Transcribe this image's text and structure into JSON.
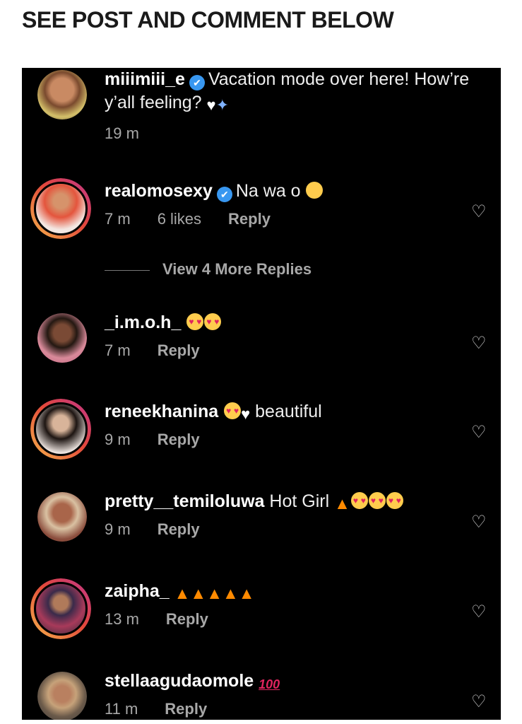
{
  "headline": "SEE POST AND COMMENT BELOW",
  "post": {
    "username": "miiimiii_e",
    "caption": "Vacation mode over here! How’re y’all feeling?",
    "time": "19 m"
  },
  "view_more": "View 4 More Replies",
  "comments": [
    {
      "username": "realomosexy",
      "verified": true,
      "text": "Na wa o",
      "time": "7 m",
      "likes": "6 likes",
      "reply": "Reply"
    },
    {
      "username": "_i.m.o.h_",
      "text": "",
      "time": "7 m",
      "reply": "Reply"
    },
    {
      "username": "reneekhanina",
      "text": "beautiful",
      "time": "9 m",
      "reply": "Reply"
    },
    {
      "username": "pretty__temiloluwa",
      "text": "Hot Girl",
      "time": "9 m",
      "reply": "Reply"
    },
    {
      "username": "zaipha_",
      "text": "",
      "time": "13 m",
      "reply": "Reply"
    },
    {
      "username": "stellaagudaomole",
      "text": "",
      "time": "11 m",
      "reply": "Reply"
    }
  ],
  "icons": {
    "like": "heart-outline-icon",
    "verified": "verified-badge-icon"
  },
  "colors": {
    "background": "#000000",
    "meta": "#a8a8a8",
    "verified": "#3897f0"
  }
}
